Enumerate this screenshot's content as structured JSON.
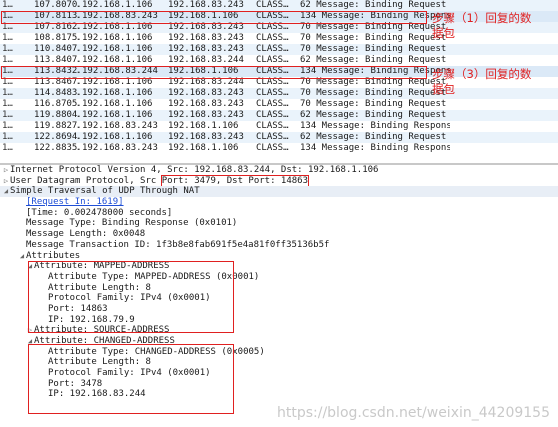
{
  "packets": [
    {
      "no": "1…",
      "time": "107.8070…",
      "src": "192.168.1.106",
      "dst": "192.168.83.243",
      "proto": "CLASS…",
      "info": "62 Message: Binding Request"
    },
    {
      "no": "1…",
      "time": "107.8113…",
      "src": "192.168.83.243",
      "dst": "192.168.1.106",
      "proto": "CLASS…",
      "info": "134 Message: Binding Response"
    },
    {
      "no": "1…",
      "time": "107.8162…",
      "src": "192.168.1.106",
      "dst": "192.168.83.243",
      "proto": "CLASS…",
      "info": "70 Message: Binding Request"
    },
    {
      "no": "1…",
      "time": "108.8175…",
      "src": "192.168.1.106",
      "dst": "192.168.83.243",
      "proto": "CLASS…",
      "info": "70 Message: Binding Request"
    },
    {
      "no": "1…",
      "time": "110.8407…",
      "src": "192.168.1.106",
      "dst": "192.168.83.243",
      "proto": "CLASS…",
      "info": "70 Message: Binding Request"
    },
    {
      "no": "1…",
      "time": "113.8407…",
      "src": "192.168.1.106",
      "dst": "192.168.83.244",
      "proto": "CLASS…",
      "info": "62 Message: Binding Request"
    },
    {
      "no": "1…",
      "time": "113.8432…",
      "src": "192.168.83.244",
      "dst": "192.168.1.106",
      "proto": "CLASS…",
      "info": "134 Message: Binding Response"
    },
    {
      "no": "1…",
      "time": "113.8467…",
      "src": "192.168.1.106",
      "dst": "192.168.83.244",
      "proto": "CLASS…",
      "info": "70 Message: Binding Request"
    },
    {
      "no": "1…",
      "time": "114.8483…",
      "src": "192.168.1.106",
      "dst": "192.168.83.243",
      "proto": "CLASS…",
      "info": "70 Message: Binding Request"
    },
    {
      "no": "1…",
      "time": "116.8705…",
      "src": "192.168.1.106",
      "dst": "192.168.83.243",
      "proto": "CLASS…",
      "info": "70 Message: Binding Request"
    },
    {
      "no": "1…",
      "time": "119.8804…",
      "src": "192.168.1.106",
      "dst": "192.168.83.243",
      "proto": "CLASS…",
      "info": "62 Message: Binding Request"
    },
    {
      "no": "1…",
      "time": "119.8827…",
      "src": "192.168.83.243",
      "dst": "192.168.1.106",
      "proto": "CLASS…",
      "info": "134 Message: Binding Response"
    },
    {
      "no": "1…",
      "time": "122.8694…",
      "src": "192.168.1.106",
      "dst": "192.168.83.243",
      "proto": "CLASS…",
      "info": "62 Message: Binding Request"
    },
    {
      "no": "1…",
      "time": "122.8835…",
      "src": "192.168.83.243",
      "dst": "192.168.1.106",
      "proto": "CLASS…",
      "info": "134 Message: Binding Response"
    }
  ],
  "annotations": {
    "step1_line1": "步骤（1）回复的数",
    "step1_line2": "据包",
    "step3_line1": "步骤（3）回复的数",
    "step3_line2": "据包"
  },
  "details": {
    "ip": "Internet Protocol Version 4, Src: 192.168.83.244, Dst: 192.168.1.106",
    "udp_prefix": "User Datagram Protocol, Src ",
    "udp_ports": "Port: 3479, Dst Port: 14863",
    "stun": "Simple Traversal of UDP Through NAT",
    "request_in": "[Request In: 1619]",
    "time": "[Time: 0.002478000 seconds]",
    "msg_type": "Message Type: Binding Response (0x0101)",
    "msg_length": "Message Length: 0x0048",
    "txn_id": "Message Transaction ID: 1f3b8e8fab691f5e4a81f0ff35136b5f",
    "attributes": "Attributes",
    "mapped": {
      "header": "Attribute: MAPPED-ADDRESS",
      "type": "Attribute Type: MAPPED-ADDRESS (0x0001)",
      "length": "Attribute Length: 8",
      "family": "Protocol Family: IPv4 (0x0001)",
      "port": "Port: 14863",
      "ip": "IP: 192.168.79.9"
    },
    "source": "Attribute: SOURCE-ADDRESS",
    "changed": {
      "header": "Attribute: CHANGED-ADDRESS",
      "type": "Attribute Type: CHANGED-ADDRESS (0x0005)",
      "length": "Attribute Length: 8",
      "family": "Protocol Family: IPv4 (0x0001)",
      "port": "Port: 3478",
      "ip": "IP: 192.168.83.244"
    }
  },
  "watermark": "https://blog.csdn.net/weixin_44209155",
  "colors": {
    "highlight": "#e02020",
    "link": "#1f4fd6",
    "row_alt": "#eaf3fb"
  }
}
